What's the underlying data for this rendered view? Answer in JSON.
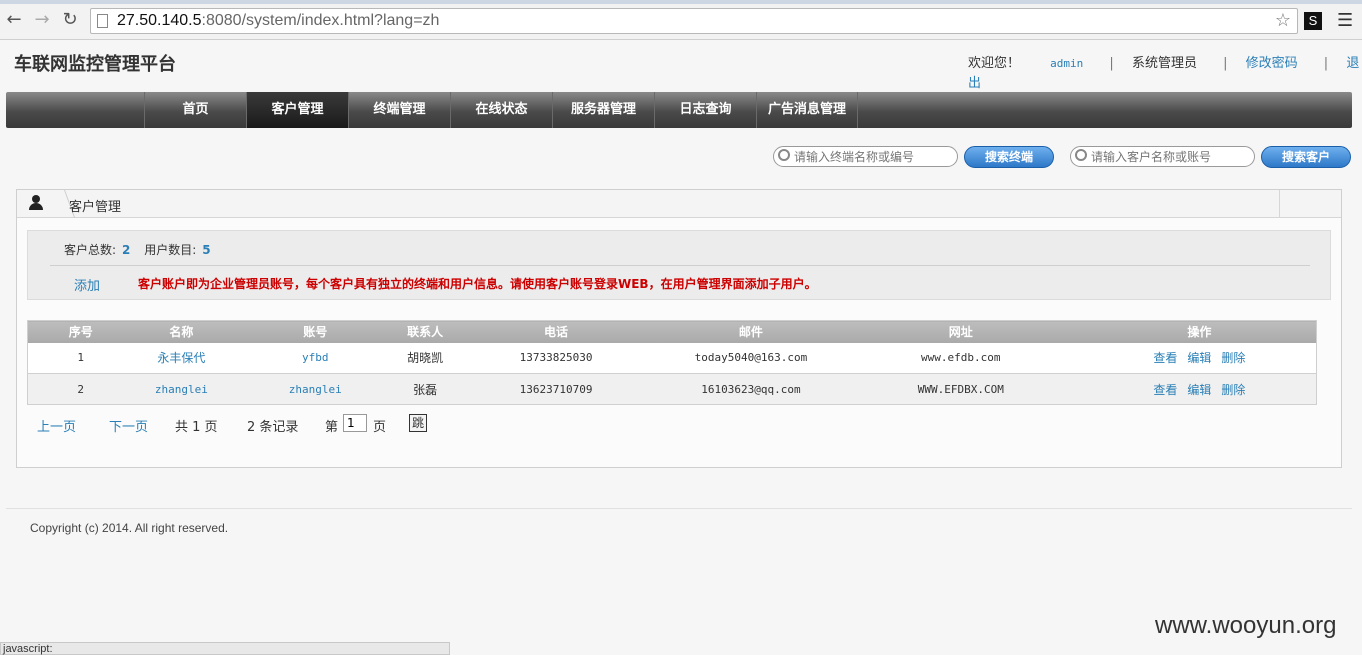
{
  "browser": {
    "url_host": "27.50.140.5",
    "url_rest": ":8080/system/index.html?lang=zh",
    "ext_label": "S"
  },
  "header": {
    "title": "车联网监控管理平台",
    "welcome": "欢迎您！",
    "username": "admin",
    "role": "系统管理员",
    "change_password": "修改密码",
    "logout_part1": "退",
    "logout_part2": "出"
  },
  "nav": {
    "items": [
      "首页",
      "客户管理",
      "终端管理",
      "在线状态",
      "服务器管理",
      "日志查询",
      "广告消息管理"
    ],
    "active": "客户管理"
  },
  "search": {
    "terminal_placeholder": "请输入终端名称或编号",
    "terminal_button": "搜索终端",
    "customer_placeholder": "请输入客户名称或账号",
    "customer_button": "搜索客户"
  },
  "panel": {
    "title": "客户管理",
    "stats_customers_label": "客户总数:",
    "stats_customers": "2",
    "stats_users_label": "用户数目:",
    "stats_users": "5",
    "add_label": "添加",
    "notice": "客户账户即为企业管理员账号，每个客户具有独立的终端和用户信息。请使用客户账号登录WEB，在用户管理界面添加子用户。"
  },
  "table": {
    "headers": [
      "序号",
      "名称",
      "账号",
      "联系人",
      "电话",
      "邮件",
      "网址",
      "操作"
    ],
    "rows": [
      {
        "no": "1",
        "name": "永丰保代",
        "account": "yfbd",
        "contact": "胡晓凯",
        "phone": "13733825030",
        "email": "today5040@163.com",
        "site": "www.efdb.com"
      },
      {
        "no": "2",
        "name": "zhanglei",
        "account": "zhanglei",
        "contact": "张磊",
        "phone": "13623710709",
        "email": "16103623@qq.com",
        "site": "WWW.EFDBX.COM"
      }
    ],
    "ops": {
      "view": "查看",
      "edit": "编辑",
      "delete": "删除"
    }
  },
  "pager": {
    "prev": "上一页",
    "next": "下一页",
    "total_pages": "共 1 页",
    "total_records": "2 条记录",
    "page_prefix": "第",
    "page_value": "1",
    "page_suffix": "页",
    "go": "跳"
  },
  "footer": {
    "copyright": "Copyright (c) 2014. All right reserved.",
    "status": "javascript:",
    "watermark": "www.wooyun.org"
  }
}
